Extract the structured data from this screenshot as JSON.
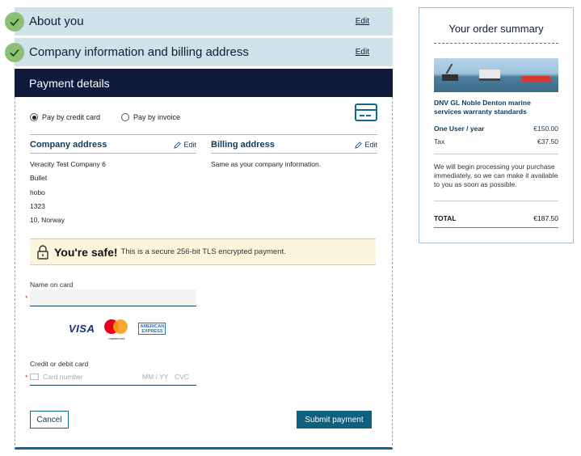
{
  "steps": [
    {
      "title": "About you",
      "edit_label": "Edit"
    },
    {
      "title": "Company information and billing address",
      "edit_label": "Edit"
    }
  ],
  "payment": {
    "header": "Payment details",
    "options": [
      {
        "label": "Pay by credit card",
        "selected": true
      },
      {
        "label": "Pay by invoice",
        "selected": false
      }
    ],
    "company_address": {
      "title": "Company address",
      "edit_label": "Edit",
      "lines": [
        "Veracity Test Company 6",
        "Bullet",
        "hobo",
        "1323",
        "10, Norway"
      ]
    },
    "billing_address": {
      "title": "Billing address",
      "edit_label": "Edit",
      "text": "Same as your company information."
    },
    "safe": {
      "title": "You're safe!",
      "text": "This is a secure 256-bit TLS encrypted payment."
    },
    "name_on_card": {
      "label": "Name on card",
      "value": "",
      "required_mark": "*"
    },
    "brands": {
      "visa": "VISA",
      "mastercard": "mastercard",
      "amex": "AMERICAN EXPRESS"
    },
    "card": {
      "label": "Credit or debit card",
      "required_mark": "*",
      "number_placeholder": "Card number",
      "expiry_placeholder": "MM / YY",
      "cvc_placeholder": "CVC"
    },
    "cancel_label": "Cancel",
    "submit_label": "Submit payment"
  },
  "summary": {
    "title": "Your order summary",
    "product": "DNV GL Noble Denton marine services warranty standards",
    "item_label": "One User / year",
    "item_price": "€150.00",
    "tax_label": "Tax",
    "tax_price": "€37.50",
    "note": "We will begin processing your purchase immediately, so we can make it available to you as soon as possible.",
    "total_label": "TOTAL",
    "total_price": "€187.50"
  },
  "colors": {
    "step_bg": "#cfe1e9",
    "header_bg": "#0f1a3d",
    "accent": "#0f5f7e",
    "check": "#8cc075",
    "safe_bg": "#fcf5dc"
  }
}
